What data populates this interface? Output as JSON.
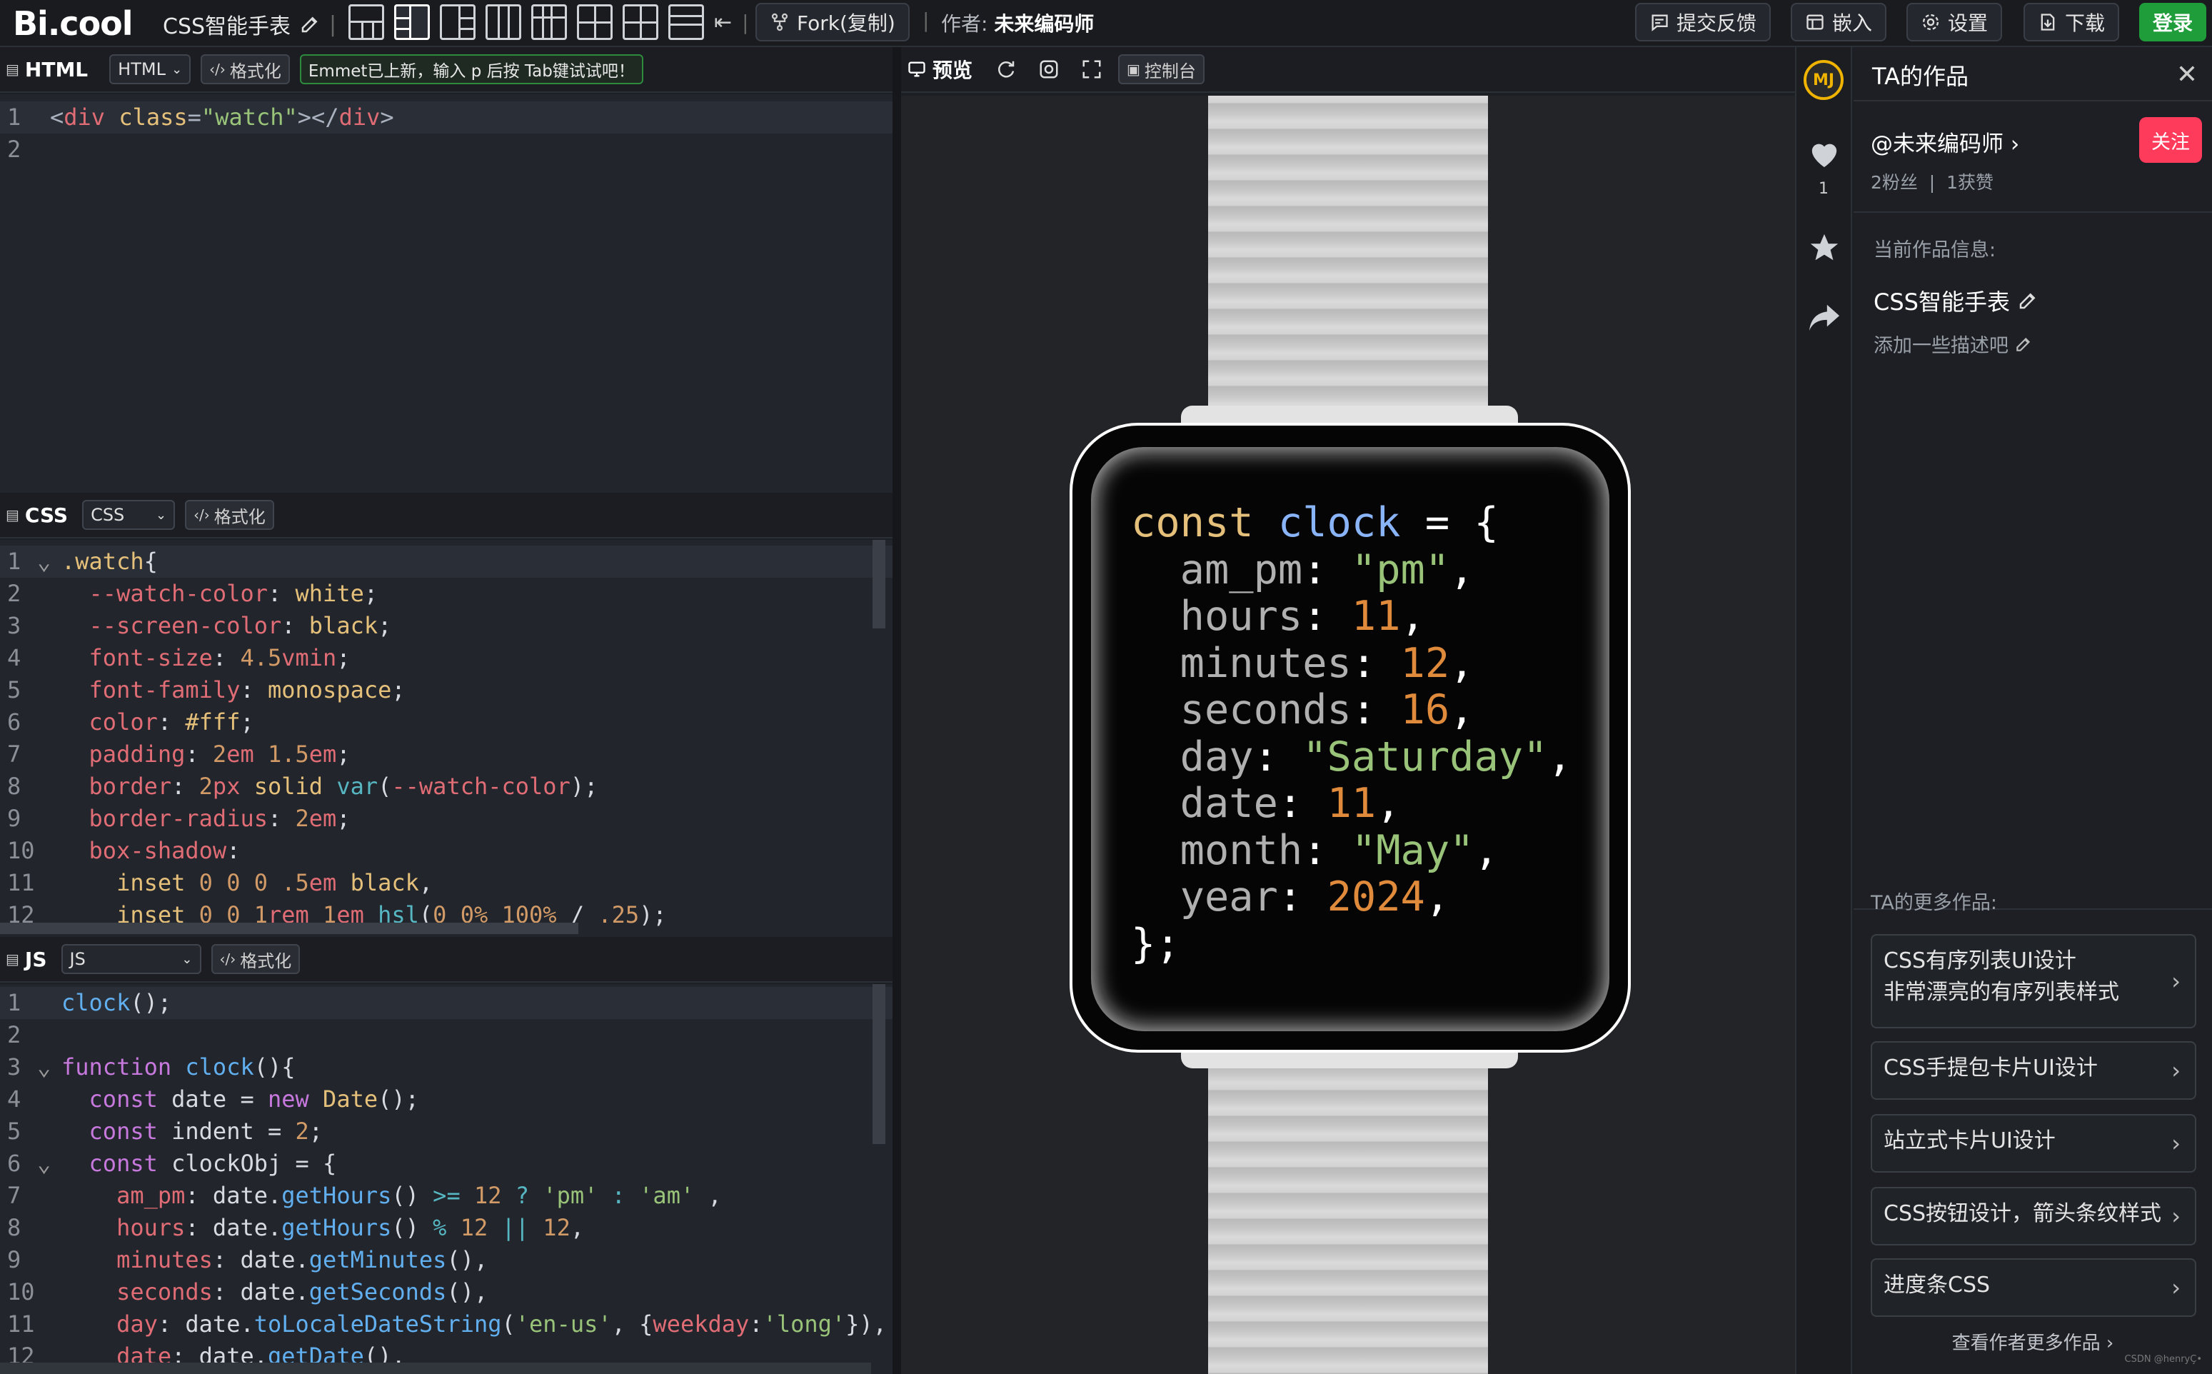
{
  "header": {
    "logo": "Bi.cool",
    "project_title": "CSS智能手表",
    "fork_label": "Fork(复制)",
    "author_label": "作者:",
    "author_name": "未来编码师",
    "feedback_label": "提交反馈",
    "embed_label": "嵌入",
    "settings_label": "设置",
    "download_label": "下载",
    "login_label": "登录"
  },
  "html_panel": {
    "title": "HTML",
    "lang_select": "HTML",
    "format_label": "格式化",
    "emmet_hint": "Emmet已上新，输入 p 后按 Tab键试试吧！",
    "lines": [
      "1",
      "2"
    ],
    "code": "<div class=\"watch\"></div>"
  },
  "css_panel": {
    "title": "CSS",
    "lang_select": "CSS",
    "format_label": "格式化"
  },
  "js_panel": {
    "title": "JS",
    "lang_select": "JS",
    "format_label": "格式化"
  },
  "preview": {
    "title": "预览",
    "console_label": "控制台",
    "watch_code": {
      "line1": "const clock = {",
      "line2": "am_pm: \"pm\",",
      "line3": "hours: 11,",
      "line4": "minutes: 12,",
      "line5": "seconds: 16,",
      "line6": "day: \"Saturday\",",
      "line7": "date: 11,",
      "line8": "month: \"May\",",
      "line9": "year: 2024,",
      "line10": "};"
    }
  },
  "side_actions": {
    "avatar_text": "MJ",
    "like_count": "1"
  },
  "right_panel": {
    "title": "TA的作品",
    "author_handle": "@未来编码师",
    "follow_label": "关注",
    "stats": "2粉丝  |  1获赞",
    "current_info_label": "当前作品信息:",
    "work_title": "CSS智能手表",
    "add_desc": "添加一些描述吧",
    "more_works_label": "TA的更多作品:",
    "more_works": [
      {
        "line1": "CSS有序列表UI设计",
        "line2": "非常漂亮的有序列表样式"
      },
      {
        "line1": "CSS手提包卡片UI设计"
      },
      {
        "line1": "站立式卡片UI设计"
      },
      {
        "line1": "CSS按钮设计，箭头条纹样式"
      },
      {
        "line1": "进度条CSS"
      }
    ],
    "view_more": "查看作者更多作品 ›",
    "watermark": "CSDN @henryÇ•"
  }
}
